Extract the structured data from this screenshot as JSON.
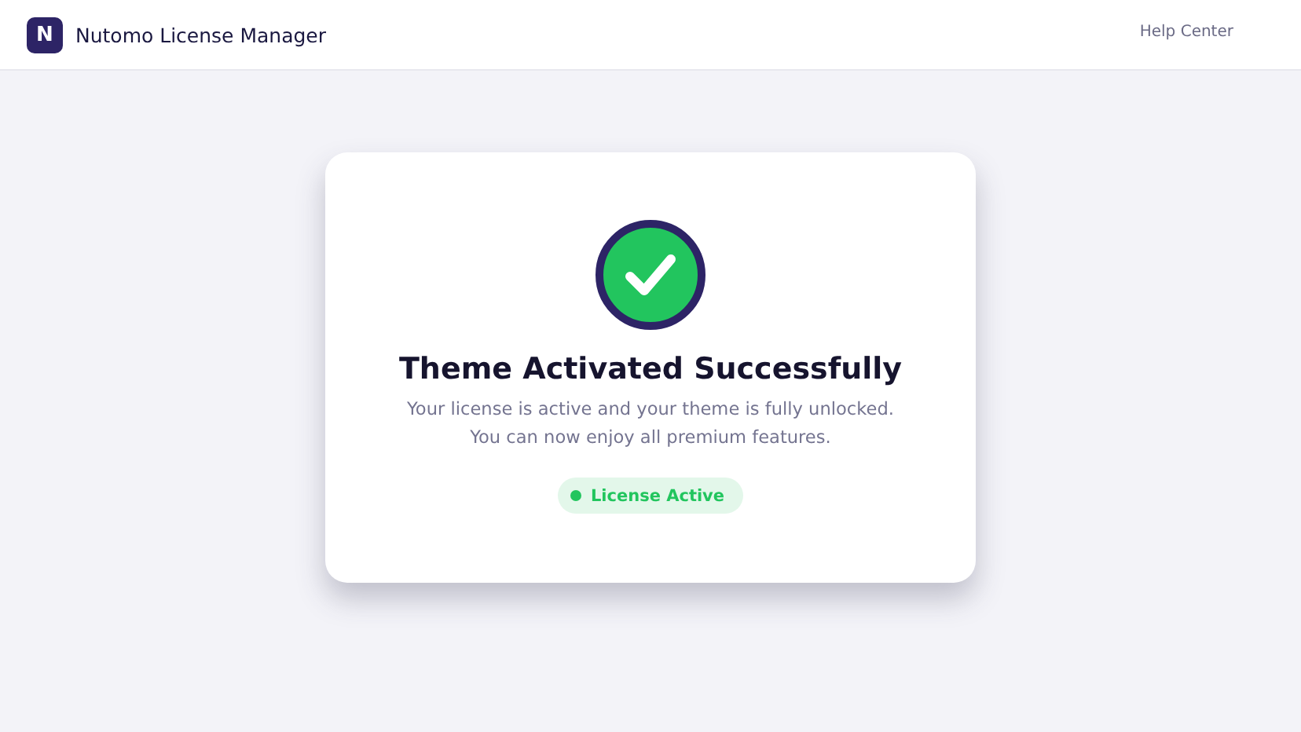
{
  "header": {
    "logo_letter": "N",
    "title": "Nutomo License Manager",
    "help_link": "Help Center"
  },
  "card": {
    "title": "Theme Activated Successfully",
    "message_lines": [
      "Your license is active and your theme is fully unlocked.",
      "You can now enjoy all premium features."
    ],
    "status": {
      "label": "License Active",
      "color": "#22c55e"
    }
  }
}
